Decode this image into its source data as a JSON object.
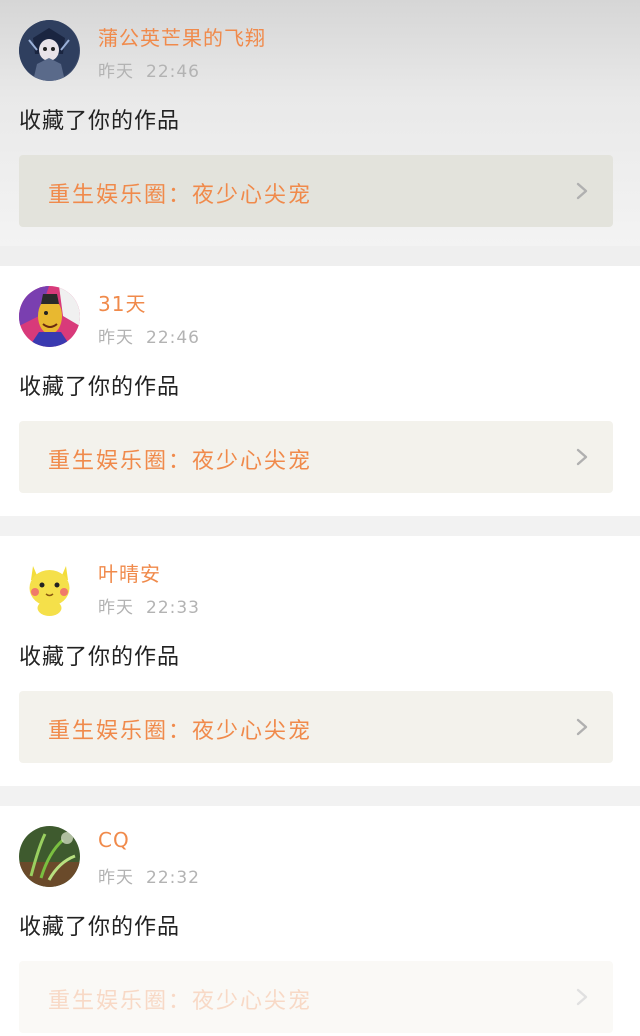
{
  "notifications": [
    {
      "username": "蒲公英芒果的飞翔",
      "day": "昨天",
      "time": "22:46",
      "action": "收藏了你的作品",
      "work_title": "重生娱乐圈：夜少心尖宠",
      "avatar_icon": "anime-character-avatar-icon",
      "avatar_color": "#2b3b5a"
    },
    {
      "username": "31天",
      "day": "昨天",
      "time": "22:46",
      "action": "收藏了你的作品",
      "work_title": "重生娱乐圈：夜少心尖宠",
      "avatar_icon": "cartoon-character-avatar-icon",
      "avatar_color": "#8a3fa0"
    },
    {
      "username": "叶晴安",
      "day": "昨天",
      "time": "22:33",
      "action": "收藏了你的作品",
      "work_title": "重生娱乐圈：夜少心尖宠",
      "avatar_icon": "yellow-pikachu-avatar-icon",
      "avatar_color": "#f5e04a"
    },
    {
      "username": "CQ",
      "day": "昨天",
      "time": "22:32",
      "action": "收藏了你的作品",
      "work_title": "重生娱乐圈：夜少心尖宠",
      "avatar_icon": "green-plant-avatar-icon",
      "avatar_color": "#4b7a3a"
    }
  ],
  "colors": {
    "accent": "#f08a4b",
    "timestamp": "#b3b3b3",
    "action_text": "#222222",
    "card_link_bg": "#f3f2ec"
  }
}
